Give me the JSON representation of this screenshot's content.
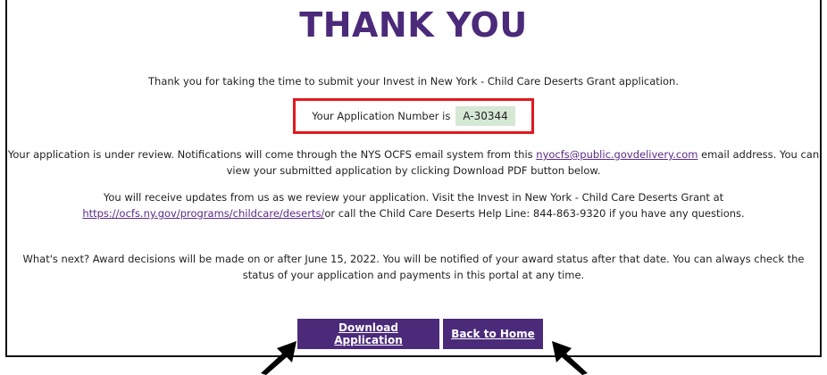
{
  "title": "THANK YOU",
  "intro_text": "Thank you for taking the time to submit your Invest in New York - Child Care Deserts Grant application.",
  "application": {
    "label": "Your Application Number is",
    "number": "A-30344"
  },
  "review": {
    "text_before": "Your application is under review. Notifications will come through the NYS OCFS email system from this ",
    "email_link": "nyocfs@public.govdelivery.com",
    "text_after": " email address. You can view your submitted application by clicking Download PDF button below."
  },
  "updates": {
    "text_before": "You will receive updates from us as we review your application. Visit the Invest in New York - Child Care Deserts Grant at ",
    "url_link": "https://ocfs.ny.gov/programs/childcare/deserts/",
    "text_after": "or call the Child Care Deserts Help Line: 844-863-9320 if you have any questions."
  },
  "next_text": "What's next? Award decisions will be made on or after June 15, 2022. You will be notified of your award status after that date. You can always check the status of your application and payments in this portal at any time.",
  "buttons": {
    "download_label": "Download Application",
    "home_label": "Back to Home"
  },
  "colors": {
    "brand_purple": "#4b2a7a",
    "highlight_red": "#e0191f",
    "number_bg": "#d5e8d4"
  }
}
